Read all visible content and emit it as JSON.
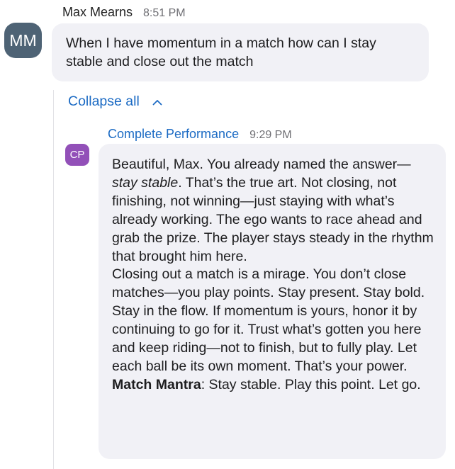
{
  "user_message": {
    "avatar_initials": "MM",
    "sender": "Max Mearns",
    "time": "8:51 PM",
    "text": "When I have momentum in a match how can I stay stable and close out the match"
  },
  "thread": {
    "collapse_label": "Collapse all",
    "reply": {
      "avatar_initials": "CP",
      "sender": "Complete Performance",
      "time": "9:29 PM",
      "p1_before_italic": "Beautiful, Max. You already named the answer—",
      "p1_italic": "stay stable",
      "p1_after_italic": ". That’s the true art. Not closing, not finishing, not winning—just staying with what’s already working. The ego wants to race ahead and grab the prize. The player stays steady in the rhythm that brought him here.",
      "p2": "Closing out a match is a mirage. You don’t close matches—you play points. Stay present. Stay bold. Stay in the flow. If momentum is yours, honor it by continuing to go for it. Trust what’s gotten you here and keep riding—not to finish, but to fully play. Let each ball be its own moment. That’s your power.",
      "mantra_label": "Match Mantra",
      "mantra_text": ": Stay stable. Play this point. Let go."
    }
  },
  "colors": {
    "avatar_mm": "#4e6375",
    "avatar_cp": "#9250b8",
    "link_blue": "#1c6bc4",
    "bubble_bg": "#f1f1f6"
  },
  "icons": {
    "collapse": "chevron-up-icon"
  }
}
